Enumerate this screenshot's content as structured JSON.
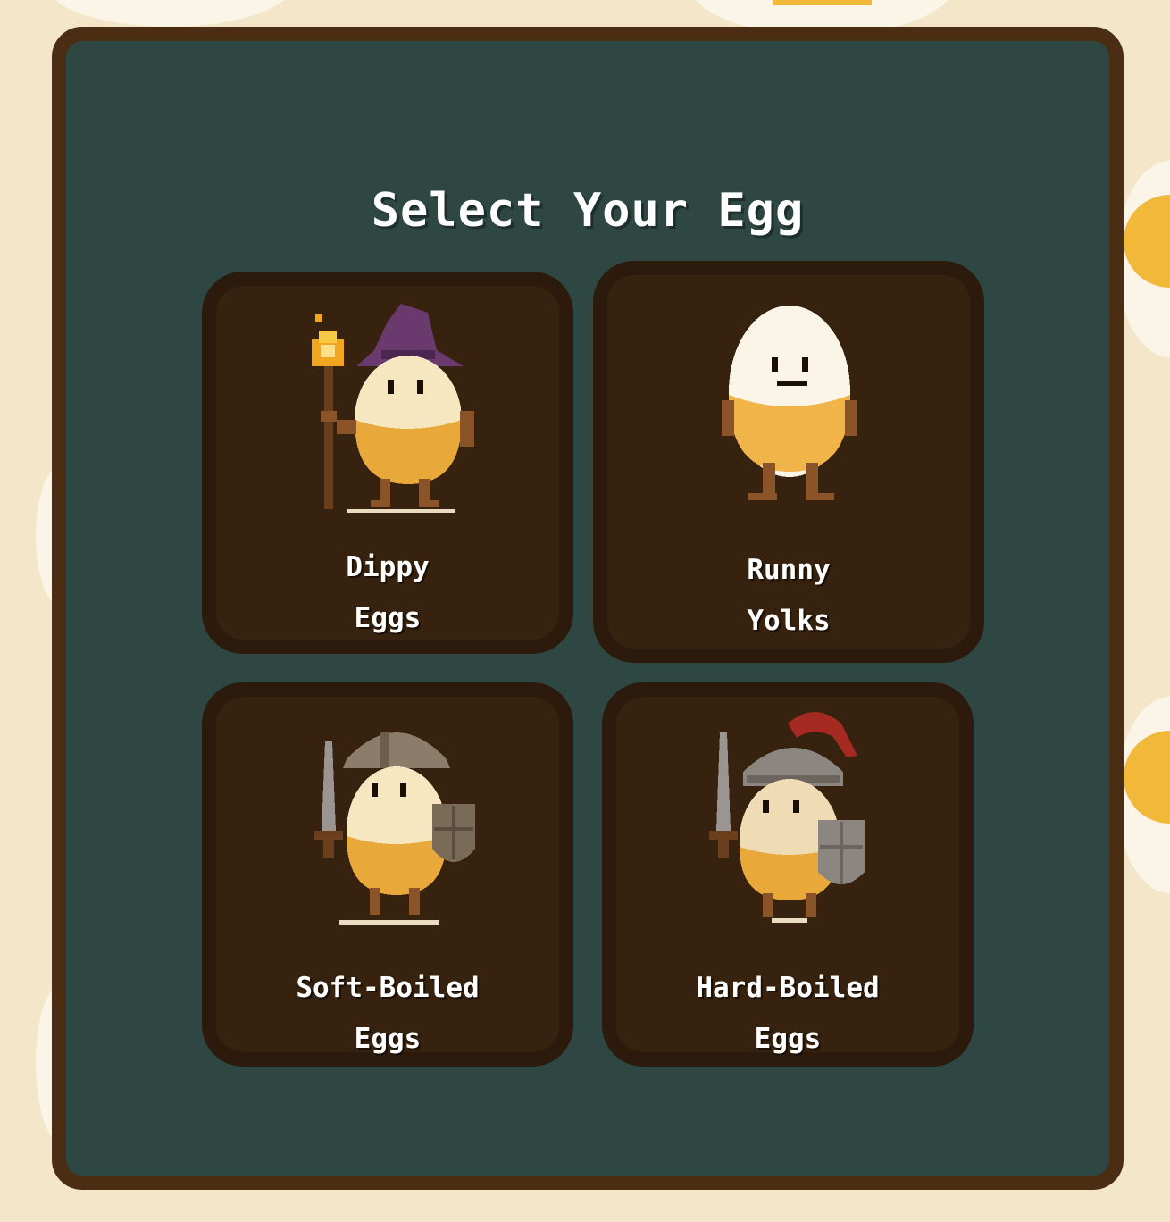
{
  "screen": {
    "title": "Select Your Egg"
  },
  "choices": [
    {
      "id": "dippy",
      "line1": "Dippy",
      "line2": "Eggs",
      "character": "wizard-egg-icon"
    },
    {
      "id": "runny",
      "line1": "Runny",
      "line2": "Yolks",
      "character": "plain-egg-icon"
    },
    {
      "id": "soft",
      "line1": "Soft-Boiled",
      "line2": "Eggs",
      "character": "warrior-egg-icon"
    },
    {
      "id": "hard",
      "line1": "Hard-Boiled",
      "line2": "Eggs",
      "character": "knight-egg-icon"
    }
  ],
  "colors": {
    "background": "#f3e6c9",
    "panel": "#2e4742",
    "panel_border": "#4a2d12",
    "card": "#37220f",
    "card_border": "#2c1a0c",
    "yolk": "#f2b83a"
  }
}
